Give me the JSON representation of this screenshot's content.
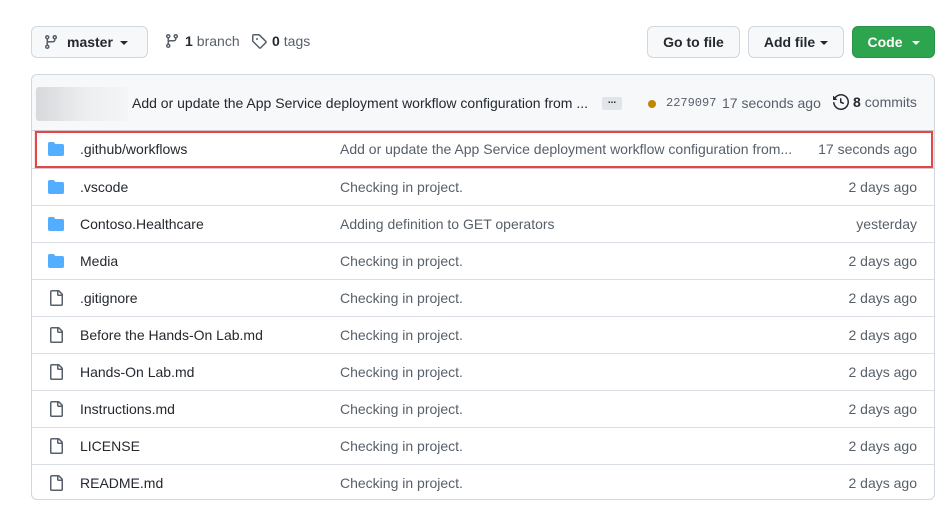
{
  "toolbar": {
    "branch_label": "master",
    "branches_count": "1",
    "branches_label": "branch",
    "tags_count": "0",
    "tags_label": "tags",
    "go_to_file_label": "Go to file",
    "add_file_label": "Add file",
    "code_label": "Code"
  },
  "latest_commit": {
    "message": "Add or update the App Service deployment workflow configuration from ...",
    "ellipsis": "...",
    "status_color": "#bf8700",
    "sha": "2279097",
    "age": "17 seconds ago",
    "commits_count": "8",
    "commits_label": "commits"
  },
  "files": [
    {
      "type": "folder",
      "icon": "folder-icon",
      "name": ".github/workflows",
      "message": "Add or update the App Service deployment workflow configuration from...",
      "age": "17 seconds ago",
      "highlighted": true
    },
    {
      "type": "folder",
      "icon": "folder-icon",
      "name": ".vscode",
      "message": "Checking in project.",
      "age": "2 days ago"
    },
    {
      "type": "folder",
      "icon": "folder-icon",
      "name": "Contoso.Healthcare",
      "message": "Adding definition to GET operators",
      "age": "yesterday"
    },
    {
      "type": "folder",
      "icon": "folder-icon",
      "name": "Media",
      "message": "Checking in project.",
      "age": "2 days ago"
    },
    {
      "type": "file",
      "icon": "file-icon",
      "name": ".gitignore",
      "message": "Checking in project.",
      "age": "2 days ago"
    },
    {
      "type": "file",
      "icon": "file-icon",
      "name": "Before the Hands-On Lab.md",
      "message": "Checking in project.",
      "age": "2 days ago"
    },
    {
      "type": "file",
      "icon": "file-icon",
      "name": "Hands-On Lab.md",
      "message": "Checking in project.",
      "age": "2 days ago"
    },
    {
      "type": "file",
      "icon": "file-icon",
      "name": "Instructions.md",
      "message": "Checking in project.",
      "age": "2 days ago"
    },
    {
      "type": "file",
      "icon": "file-icon",
      "name": "LICENSE",
      "message": "Checking in project.",
      "age": "2 days ago"
    },
    {
      "type": "file",
      "icon": "file-icon",
      "name": "README.md",
      "message": "Checking in project.",
      "age": "2 days ago"
    }
  ],
  "colors": {
    "folder": "#54aeff",
    "file": "#57606a",
    "code_button": "#2da44e",
    "highlight_border": "#e0484a"
  }
}
